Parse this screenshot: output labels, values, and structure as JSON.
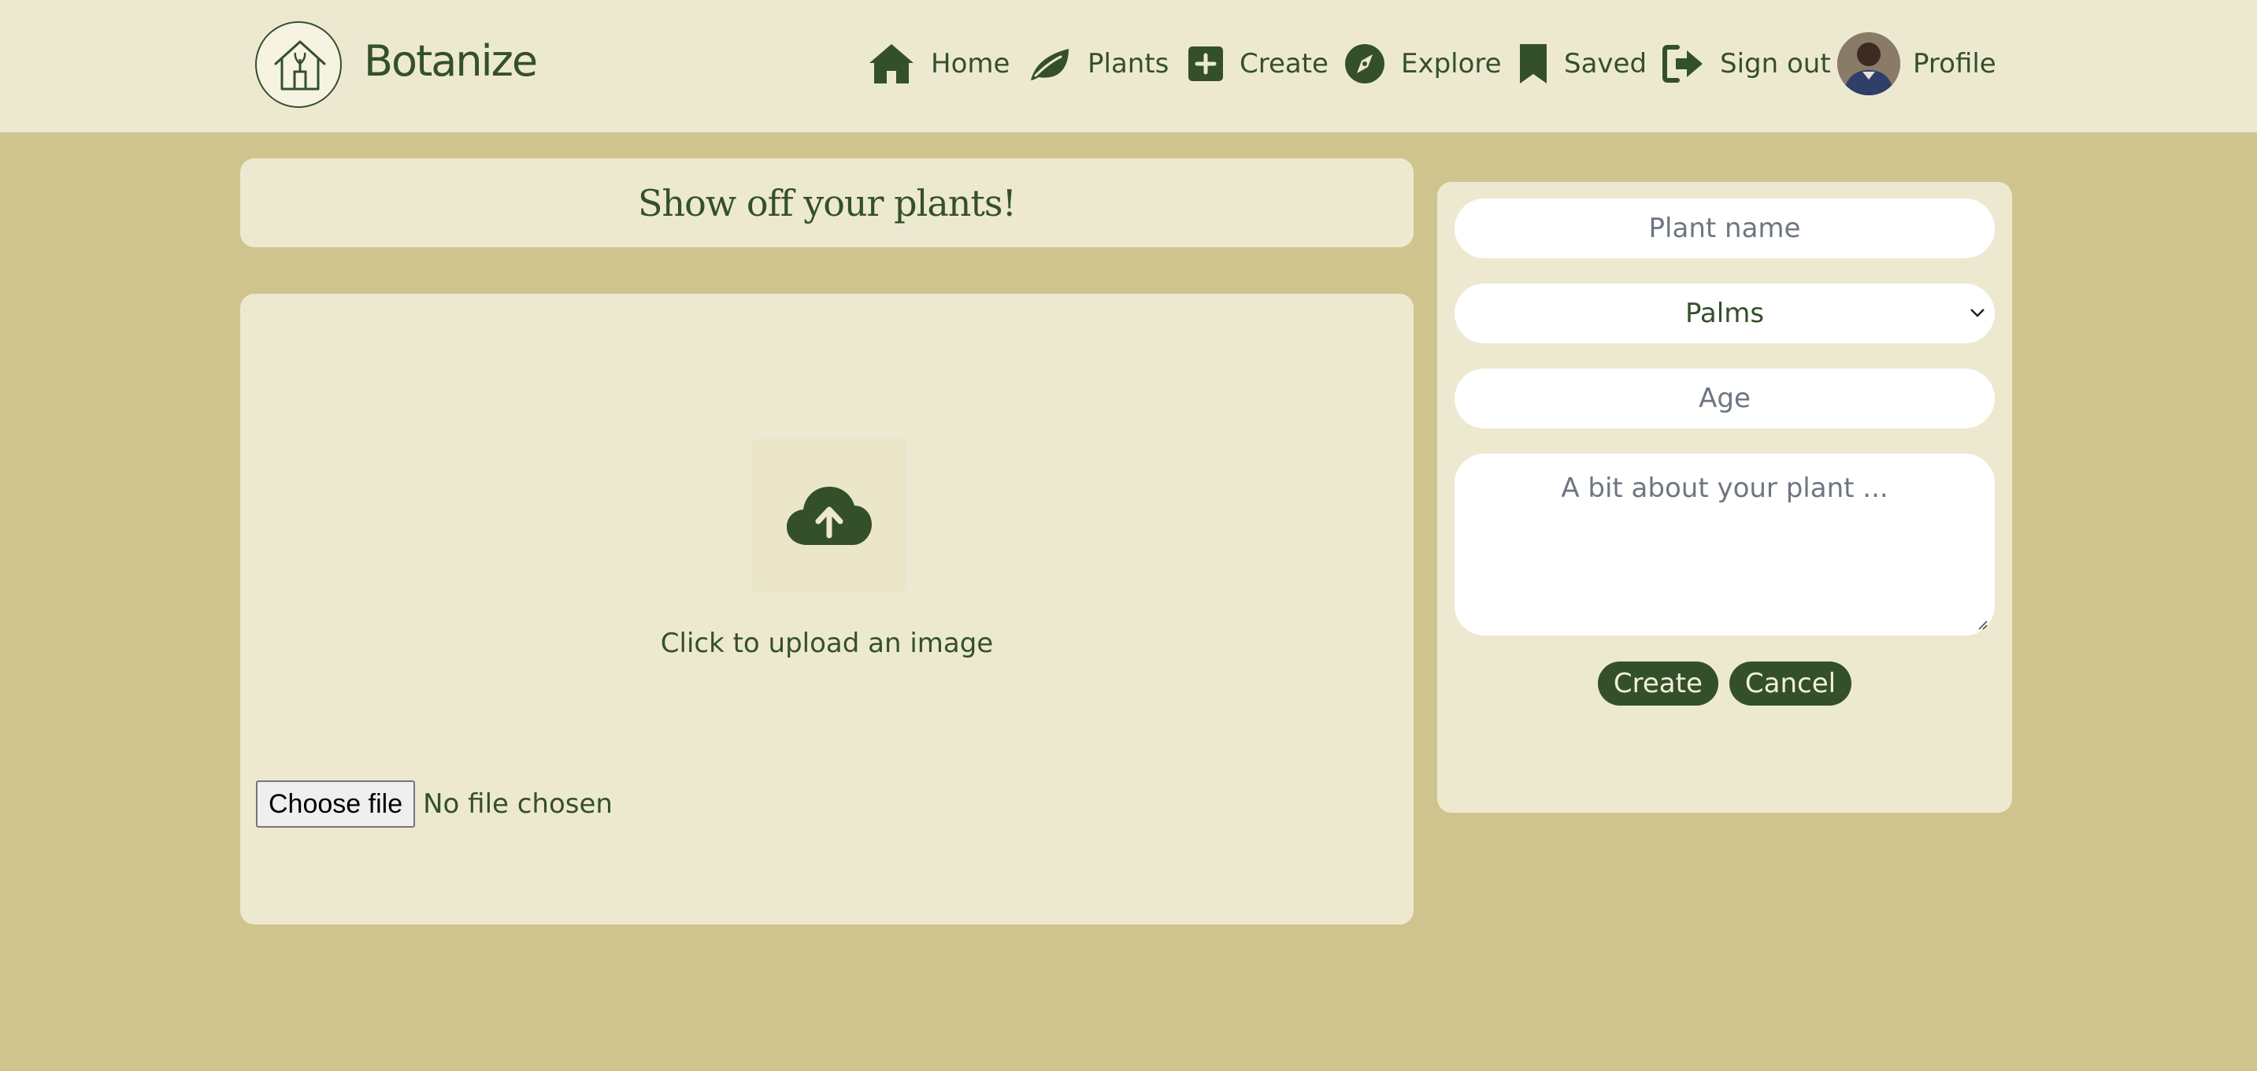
{
  "header": {
    "brand": "Botanize",
    "nav": [
      {
        "label": "Home",
        "icon": "house-icon"
      },
      {
        "label": "Plants",
        "icon": "leaf-icon"
      },
      {
        "label": "Create",
        "icon": "plus-square-icon"
      },
      {
        "label": "Explore",
        "icon": "compass-icon"
      },
      {
        "label": "Saved",
        "icon": "bookmark-icon"
      },
      {
        "label": "Sign out",
        "icon": "sign-out-icon"
      },
      {
        "label": "Profile",
        "icon": "avatar"
      }
    ]
  },
  "main": {
    "title": "Show off your plants!",
    "upload": {
      "icon": "cloud-upload-icon",
      "text": "Click to upload an image",
      "file_button": "Choose file",
      "file_status": "No file chosen"
    }
  },
  "form": {
    "plant_name_placeholder": "Plant name",
    "category_value": "Palms",
    "age_placeholder": "Age",
    "about_placeholder": "A bit about your plant ...",
    "create_label": "Create",
    "cancel_label": "Cancel"
  },
  "colors": {
    "page_background": "#d0c48e",
    "panel_background": "#ede9d1",
    "accent_green": "#34502b",
    "button_text": "#f3efdc"
  }
}
